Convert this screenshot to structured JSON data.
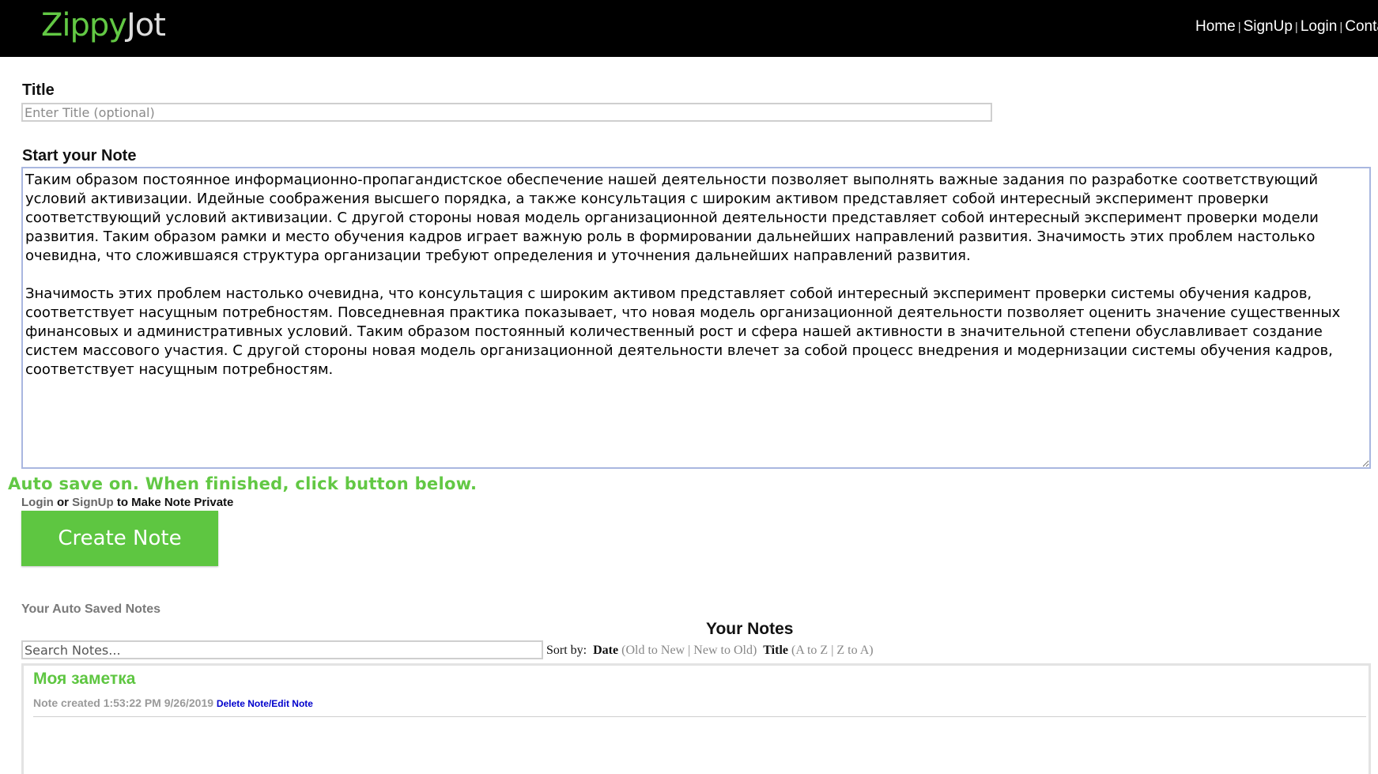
{
  "header": {
    "logo_part1": "Zippy",
    "logo_part2": "Jot",
    "nav": {
      "home": "Home",
      "signup": "SignUp",
      "login": "Login",
      "contact": "Contact",
      "separator": "|"
    }
  },
  "form": {
    "title_label": "Title",
    "title_placeholder": "Enter Title (optional)",
    "title_value": "",
    "note_label": "Start your Note",
    "note_value": "Таким образом постоянное информационно-пропагандистское обеспечение нашей деятельности позволяет выполнять важные задания по разработке соответствующий условий активизации. Идейные соображения высшего порядка, а также консультация с широким активом представляет собой интересный эксперимент проверки соответствующий условий активизации. С другой стороны новая модель организационной деятельности представляет собой интересный эксперимент проверки модели развития. Таким образом рамки и место обучения кадров играет важную роль в формировании дальнейших направлений развития. Значимость этих проблем настолько очевидна, что сложившаяся структура организации требуют определения и уточнения дальнейших направлений развития.\n\nЗначимость этих проблем настолько очевидна, что консультация с широким активом представляет собой интересный эксперимент проверки системы обучения кадров, соответствует насущным потребностям. Повседневная практика показывает, что новая модель организационной деятельности позволяет оценить значение существенных финансовых и административных условий. Таким образом постоянный количественный рост и сфера нашей активности в значительной степени обуславливает создание систем массового участия. С другой стороны новая модель организационной деятельности влечет за собой процесс внедрения и модернизации системы обучения кадров, соответствует насущным потребностям.",
    "autosave_message": "Auto save on. When finished, click button below.",
    "private_login": "Login",
    "private_or": " or ",
    "private_signup": "SignUp",
    "private_suffix": " to Make Note Private",
    "create_button": "Create Note"
  },
  "notes": {
    "auto_saved_heading": "Your Auto Saved Notes",
    "your_notes_heading": "Your Notes",
    "search_placeholder": "Search Notes...",
    "sort": {
      "prefix": "Sort by: ",
      "date_label": "Date",
      "date_old_new": "Old to New",
      "date_new_old": "New to Old",
      "title_label": "Title",
      "title_a_z": "A to Z",
      "title_z_a": "Z to A"
    },
    "items": [
      {
        "title": "Моя заметка",
        "created": "Note created 1:53:22 PM 9/26/2019",
        "delete_label": "Delete Note",
        "edit_label": "Edit Note"
      }
    ]
  },
  "colors": {
    "brand_green": "#5ec641",
    "header_bg": "#000000",
    "link_blue": "#0000cc"
  }
}
